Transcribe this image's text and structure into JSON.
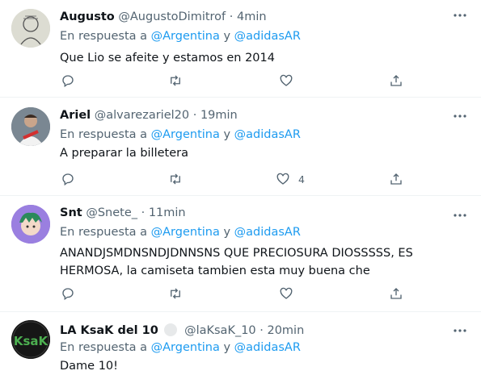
{
  "colors": {
    "link": "#1d9bf0",
    "muted": "#536471",
    "text": "#0f1419",
    "divider": "#eff3f4"
  },
  "tweets": [
    {
      "name": "Augusto",
      "handle": "@AugustoDimitrof",
      "dot": "·",
      "time": "4min",
      "reply_prefix": "En respuesta a",
      "reply_to_1": "@Argentina",
      "reply_and": "y",
      "reply_to_2": "@adidasAR",
      "text": "Que Lio se afeite y estamos en 2014",
      "likes": ""
    },
    {
      "name": "Ariel",
      "handle": "@alvarezariel20",
      "dot": "·",
      "time": "19min",
      "reply_prefix": "En respuesta a",
      "reply_to_1": "@Argentina",
      "reply_and": "y",
      "reply_to_2": "@adidasAR",
      "text": "A preparar la billetera",
      "likes": "4"
    },
    {
      "name": "Snt",
      "handle": "@Snete_",
      "dot": "·",
      "time": "11min",
      "reply_prefix": "En respuesta a",
      "reply_to_1": "@Argentina",
      "reply_and": "y",
      "reply_to_2": "@adidasAR",
      "text": "ANANDJSMDNSNDJDNNSNS QUE PRECIOSURA DIOSSSSS, ES HERMOSA, la camiseta tambien esta muy buena che",
      "likes": ""
    },
    {
      "name": "LA KsaK del 10",
      "handle": "@laKsaK_10",
      "dot": "·",
      "time": "20min",
      "reply_prefix": "En respuesta a",
      "reply_to_1": "@Argentina",
      "reply_and": "y",
      "reply_to_2": "@adidasAR",
      "text": "Dame 10!",
      "avatar_text": "KsaK",
      "likes": ""
    }
  ]
}
